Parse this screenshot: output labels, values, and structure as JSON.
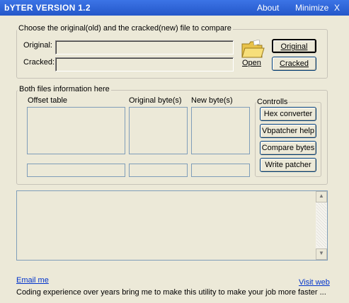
{
  "window": {
    "title": "bYTER VERSION 1.2",
    "about": "About",
    "minimize": "Minimize",
    "close": "X"
  },
  "compare_group": {
    "legend": "Choose the original(old) and the cracked(new) file to compare",
    "original_label": "Original:",
    "cracked_label": "Cracked:",
    "original_value": "",
    "cracked_value": "",
    "open_label": "Open",
    "original_button": "Original",
    "cracked_button": "Cracked"
  },
  "info_group": {
    "legend": "Both files information here",
    "offset_header": "Offset table",
    "original_bytes_header": "Original byte(s)",
    "new_bytes_header": "New byte(s)"
  },
  "controls": {
    "legend": "Controlls",
    "hex_converter": "Hex converter",
    "vbpatcher_help": "Vbpatcher help",
    "compare_bytes": "Compare bytes",
    "write_patcher": "Write patcher"
  },
  "footer": {
    "email": "Email me",
    "visit": "Visit web",
    "tagline": "Coding experience over years bring me to make this utility to make your job more faster ..."
  },
  "colors": {
    "titlebar": "#2b5fd1",
    "face": "#ece9d8",
    "link": "#0033cc"
  }
}
